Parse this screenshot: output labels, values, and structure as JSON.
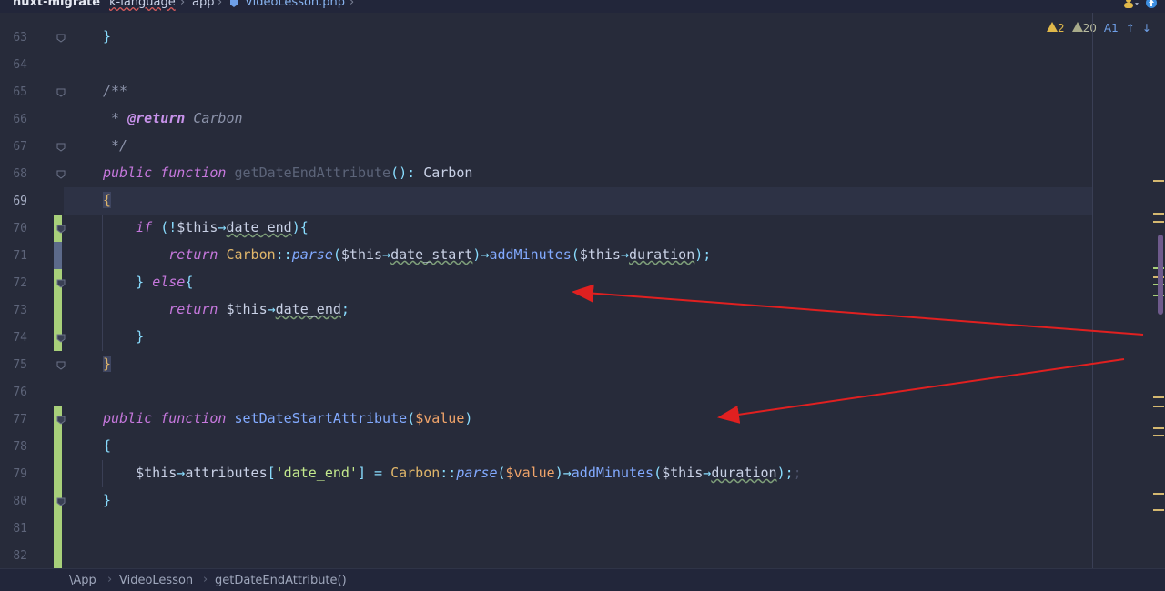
{
  "breadcrumb": {
    "project": "nuxt-migrate",
    "parts": [
      "k-language",
      "app",
      "VideoLesson.php"
    ]
  },
  "inspections": {
    "errors": "2",
    "warnings": "20",
    "typos": "1"
  },
  "line_numbers": [
    "63",
    "64",
    "65",
    "66",
    "67",
    "68",
    "69",
    "70",
    "71",
    "72",
    "73",
    "74",
    "75",
    "76",
    "77",
    "78",
    "79",
    "80",
    "81",
    "82"
  ],
  "current_line": "69",
  "code": {
    "l63": "}",
    "l65": "/**",
    "l66_star": " * ",
    "l66_tag": "@return",
    "l66_type": " Carbon",
    "l67": " */",
    "l68_kw": "public function",
    "l68_fn": "getDateEndAttribute",
    "l68_sig": "(): ",
    "l68_ret": "Carbon",
    "l69": "{",
    "l70_if": "if",
    "l70_open": " (!",
    "l70_this": "$this",
    "l70_arrow": "→",
    "l70_prop": "date_end",
    "l70_close": "){",
    "l71_ret": "return",
    "l71_cls": "Carbon",
    "l71_dc": "::",
    "l71_parse": "parse",
    "l71_p1": "(",
    "l71_this1": "$this",
    "l71_arrow1": "→",
    "l71_prop1": "date_start",
    "l71_p2": ")",
    "l71_arrow2": "→",
    "l71_add": "addMinutes",
    "l71_p3": "(",
    "l71_this2": "$this",
    "l71_arrow3": "→",
    "l71_prop2": "duration",
    "l71_end": ");",
    "l72_close": "} ",
    "l72_else": "else",
    "l72_open": "{",
    "l73_ret": "return",
    "l73_this": "$this",
    "l73_arrow": "→",
    "l73_prop": "date_end",
    "l73_end": ";",
    "l74": "}",
    "l75": "}",
    "l77_kw": "public function",
    "l77_fn": "setDateStartAttribute",
    "l77_p1": "(",
    "l77_param": "$value",
    "l77_p2": ")",
    "l78": "{",
    "l79_this": "$this",
    "l79_arrow": "→",
    "l79_attr": "attributes",
    "l79_b1": "[",
    "l79_key": "'date_end'",
    "l79_b2": "]",
    "l79_eq": " = ",
    "l79_cls": "Carbon",
    "l79_dc": "::",
    "l79_parse": "parse",
    "l79_p1": "(",
    "l79_val": "$value",
    "l79_p2": ")",
    "l79_arrow2": "→",
    "l79_add": "addMinutes",
    "l79_p3": "(",
    "l79_this2": "$this",
    "l79_arrow3": "→",
    "l79_prop": "duration",
    "l79_end": ");",
    "l79_extra": ";",
    "l80": "}"
  },
  "status_path": [
    "\\App",
    "VideoLesson",
    "getDateEndAttribute()"
  ],
  "colors": {
    "background": "#272b3a",
    "keyword": "#c678dd",
    "function": "#82aaff",
    "class": "#e0b66a",
    "string": "#c3e88d",
    "annotation_arrow": "#e02020"
  }
}
